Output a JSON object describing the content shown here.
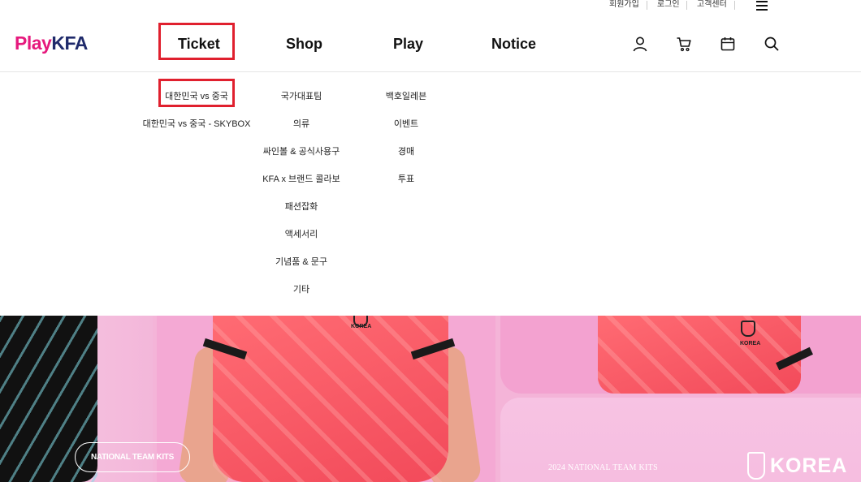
{
  "util": {
    "signup": "회원가입",
    "login": "로그인",
    "support": "고객센터"
  },
  "logo": {
    "play": "Play",
    "kfa": "KFA"
  },
  "nav": [
    {
      "label": "Ticket"
    },
    {
      "label": "Shop"
    },
    {
      "label": "Play"
    },
    {
      "label": "Notice"
    }
  ],
  "header_icons": [
    "user-icon",
    "cart-icon",
    "calendar-icon",
    "search-icon",
    "hamburger-menu-icon"
  ],
  "dropdown": {
    "ticket": [
      "대한민국 vs 중국",
      "대한민국 vs 중국 - SKYBOX"
    ],
    "shop": [
      "국가대표팀",
      "의류",
      "싸인볼 & 공식사용구",
      "KFA x 브랜드 콜라보",
      "패션잡화",
      "액세서리",
      "기념품 & 문구",
      "기타"
    ],
    "play": [
      "백호일레븐",
      "이벤트",
      "경매",
      "투표"
    ]
  },
  "hero": {
    "pill": "NATIONAL TEAM KITS",
    "kits_text": "2024 NATIONAL TEAM KITS",
    "korea": "KOREA",
    "crest_label": "KOREA"
  },
  "colors": {
    "brand_pink": "#e6197d",
    "brand_navy": "#1f2a6b",
    "highlight_red": "#e0202e",
    "hero_pink": "#f4a9d4"
  }
}
